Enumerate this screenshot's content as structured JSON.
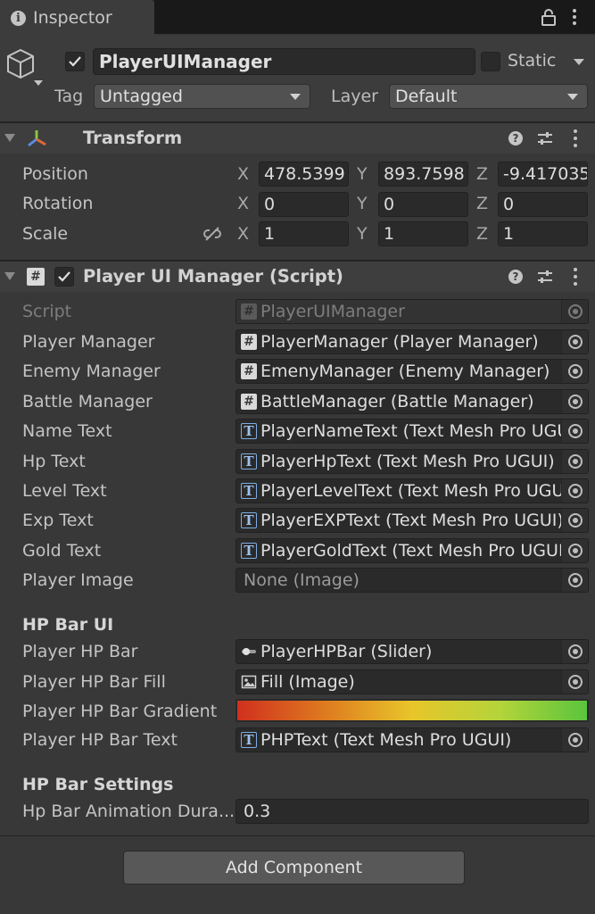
{
  "tab": {
    "title": "Inspector"
  },
  "header": {
    "active": true,
    "object_name": "PlayerUIManager",
    "static_label": "Static",
    "static_checked": false,
    "tag_label": "Tag",
    "tag_value": "Untagged",
    "layer_label": "Layer",
    "layer_value": "Default"
  },
  "transform": {
    "title": "Transform",
    "rows": [
      {
        "label": "Position",
        "x": "478.5399",
        "y": "893.7598",
        "z": "-9.417035"
      },
      {
        "label": "Rotation",
        "x": "0",
        "y": "0",
        "z": "0"
      },
      {
        "label": "Scale",
        "x": "1",
        "y": "1",
        "z": "1"
      }
    ],
    "axis": {
      "x": "X",
      "y": "Y",
      "z": "Z"
    }
  },
  "script": {
    "title": "Player UI Manager (Script)",
    "enabled": true,
    "fields": [
      {
        "label": "Script",
        "value": "PlayerUIManager",
        "icon": "hash-icon",
        "disabled": true
      },
      {
        "label": "Player Manager",
        "value": "PlayerManager (Player Manager)",
        "icon": "hash-icon"
      },
      {
        "label": "Enemy Manager",
        "value": "EmenyManager (Enemy Manager)",
        "icon": "hash-icon"
      },
      {
        "label": "Battle Manager",
        "value": "BattleManager (Battle Manager)",
        "icon": "hash-icon"
      },
      {
        "label": "Name Text",
        "value": "PlayerNameText (Text Mesh Pro UGUI)",
        "icon": "text-icon"
      },
      {
        "label": "Hp Text",
        "value": "PlayerHpText (Text Mesh Pro UGUI)",
        "icon": "text-icon"
      },
      {
        "label": "Level Text",
        "value": "PlayerLevelText (Text Mesh Pro UGUI)",
        "icon": "text-icon"
      },
      {
        "label": "Exp Text",
        "value": "PlayerEXPText (Text Mesh Pro UGUI)",
        "icon": "text-icon"
      },
      {
        "label": "Gold Text",
        "value": "PlayerGoldText (Text Mesh Pro UGUI)",
        "icon": "text-icon"
      },
      {
        "label": "Player Image",
        "value": "None (Image)",
        "icon": "none",
        "muted": true
      }
    ],
    "hp_bar_ui": {
      "heading": "HP Bar UI",
      "bar_label": "Player HP Bar",
      "bar_value": "PlayerHPBar (Slider)",
      "fill_label": "Player HP Bar Fill",
      "fill_value": "Fill (Image)",
      "gradient_label": "Player HP Bar Gradient",
      "gradient_colors": [
        "#d0301e",
        "#de7a1f",
        "#e8c62a",
        "#b4d43a",
        "#5bc43d"
      ],
      "text_label": "Player HP Bar Text",
      "text_value": "PHPText (Text Mesh Pro UGUI)"
    },
    "hp_bar_settings": {
      "heading": "HP Bar Settings",
      "duration_label": "Hp Bar Animation Dura...",
      "duration_value": "0.3"
    }
  },
  "add_component_label": "Add Component"
}
